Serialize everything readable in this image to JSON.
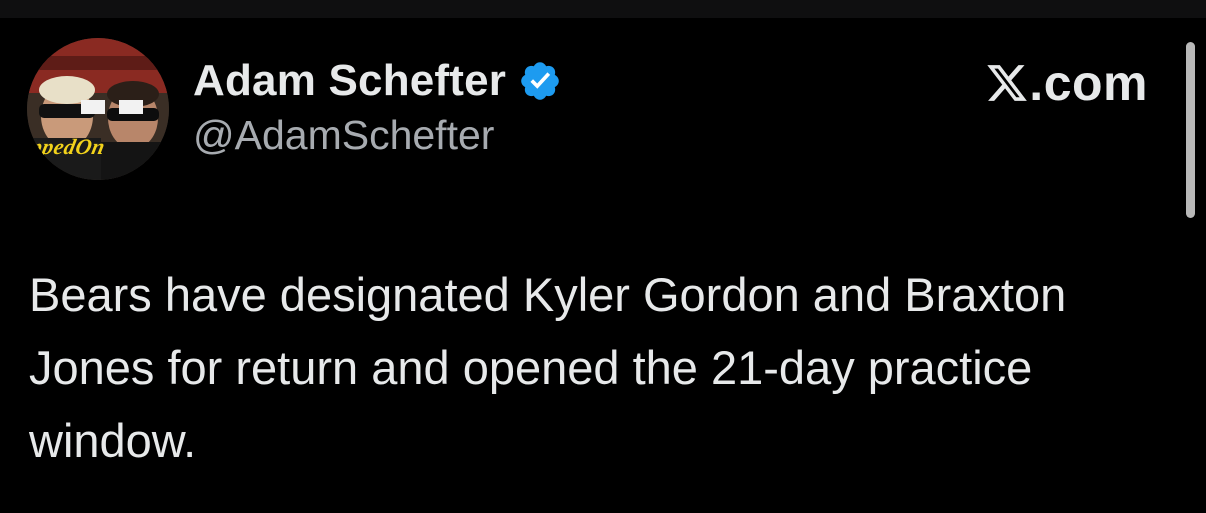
{
  "author": {
    "display_name": "Adam Schefter",
    "handle": "@AdamSchefter",
    "verified": true,
    "avatar_caption": "ppedOn"
  },
  "brand": {
    "label": ".com"
  },
  "tweet": {
    "text": "Bears have designated Kyler Gordon and Braxton Jones for return and opened the 21-day practice window."
  },
  "colors": {
    "background": "#000000",
    "text_primary": "#e7e9ea",
    "text_secondary": "#a7abb0",
    "verified_blue": "#1d9bf0",
    "avatar_caption": "#f2d21b"
  },
  "icons": {
    "verified": "verified-badge-icon",
    "brand": "x-logo-icon"
  }
}
